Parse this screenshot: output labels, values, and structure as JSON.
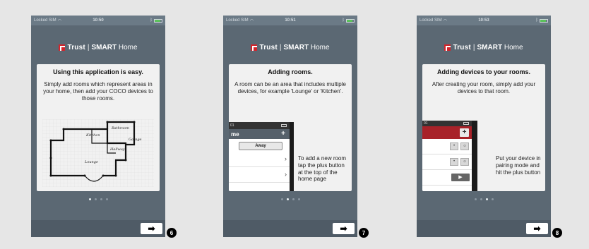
{
  "screens": [
    {
      "status": {
        "carrier": "Locked SIM",
        "time": "10:50"
      },
      "logo": {
        "brand": "Trust",
        "product_bold": "SMART",
        "product": "Home"
      },
      "title": "Using this application is easy.",
      "description": "Simply add rooms which represent areas in your home, then add your COCO devices to those rooms.",
      "floorplan_labels": {
        "kitchen": "Kitchen",
        "bathroom": "Bathroom",
        "garage": "Garage",
        "hallway": "Hallway",
        "lounge": "Lounge"
      },
      "page_index": 1,
      "step": "6"
    },
    {
      "status": {
        "carrier": "Locked SIM",
        "time": "10:51"
      },
      "logo": {
        "brand": "Trust",
        "product_bold": "SMART",
        "product": "Home"
      },
      "title": "Adding rooms.",
      "description": "A room can be an area that includes multiple devices, for example 'Lounge' or 'Kitchen'.",
      "mini": {
        "status_time": "01",
        "header": "me",
        "plus": "+",
        "away_label": "Away",
        "chevron": "›"
      },
      "side_text": "To add a new room tap the plus button at the top of the home page",
      "page_index": 2,
      "step": "7"
    },
    {
      "status": {
        "carrier": "Locked SIM",
        "time": "10:53"
      },
      "logo": {
        "brand": "Trust",
        "product_bold": "SMART",
        "product": "Home"
      },
      "title": "Adding devices to your rooms.",
      "description": "After creating your room, simply add your devices to that room.",
      "mini": {
        "status_time": "01",
        "plus": "+"
      },
      "side_text": "Put your device in pairing mode and hit the plus button",
      "page_index": 3,
      "step": "8"
    }
  ],
  "dots_count": 4,
  "next_arrow": "➡",
  "colors": {
    "phone_bg": "#5b6873",
    "statusbar": "#6b7a86",
    "card": "#f1f1f1",
    "trust_red": "#d3242b",
    "device_red": "#a82229"
  }
}
